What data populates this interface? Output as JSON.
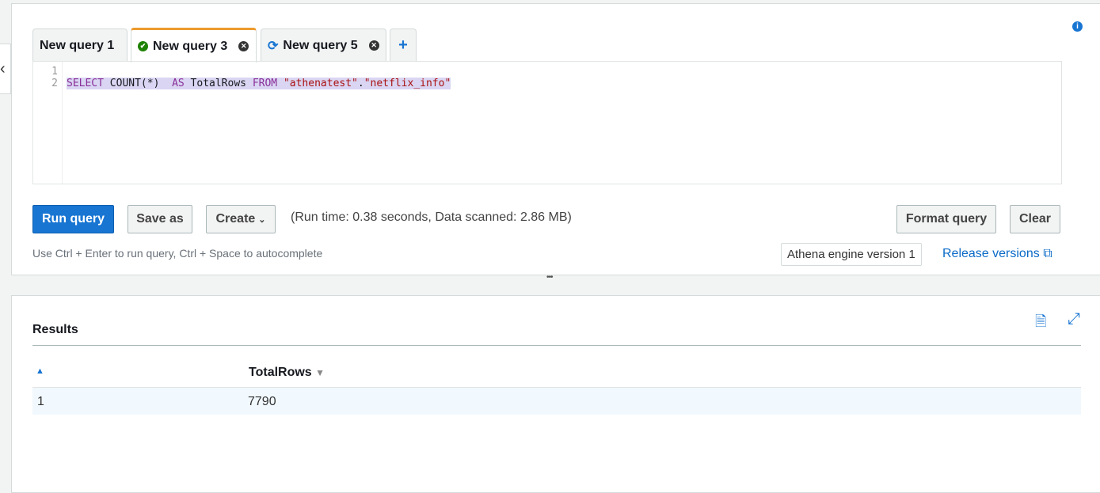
{
  "tabs": [
    {
      "label": "New query 1",
      "status": "none"
    },
    {
      "label": "New query 3",
      "status": "success"
    },
    {
      "label": "New query 5",
      "status": "running"
    }
  ],
  "add_tab": "+",
  "editor": {
    "line_numbers": [
      "1",
      "2"
    ],
    "code": {
      "select": "SELECT",
      "count": " COUNT(*)  ",
      "as": "AS",
      "alias": " TotalRows ",
      "from": "FROM",
      "db": " \"athenatest\"",
      "dot": ".",
      "table": "\"netflix_info\""
    }
  },
  "toolbar": {
    "run": "Run query",
    "save": "Save as",
    "create": "Create",
    "status": "(Run time: 0.38 seconds, Data scanned: 2.86 MB)",
    "format": "Format query",
    "clear": "Clear",
    "hint": "Use Ctrl + Enter to run query, Ctrl + Space to autocomplete",
    "engine": "Athena engine version 1",
    "release": "Release versions"
  },
  "results": {
    "title": "Results",
    "columns": [
      "",
      "TotalRows"
    ],
    "rows": [
      [
        "1",
        "7790"
      ]
    ]
  },
  "colors": {
    "accent": "#1875d2",
    "active_tab": "#ec9b2d",
    "success": "#1d8102"
  }
}
